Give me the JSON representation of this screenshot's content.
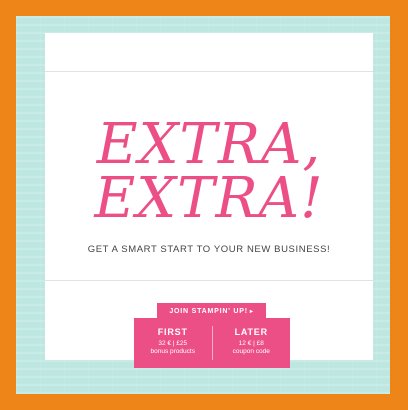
{
  "headline": {
    "line1": "EXTRA,",
    "line2": "EXTRA!"
  },
  "tagline": "GET A SMART START TO YOUR NEW BUSINESS!",
  "join_button": {
    "label": "JOIN STAMPIN' UP!",
    "arrow": "▸"
  },
  "offer": {
    "first": {
      "heading": "FIRST",
      "amount": "32 € | £25",
      "detail": "bonus products"
    },
    "later": {
      "heading": "LATER",
      "amount": "12 € | £8",
      "detail": "coupon code"
    }
  },
  "colors": {
    "frame": "#ee8518",
    "background": "#bfe7e2",
    "accent_pink": "#ec4f86"
  }
}
